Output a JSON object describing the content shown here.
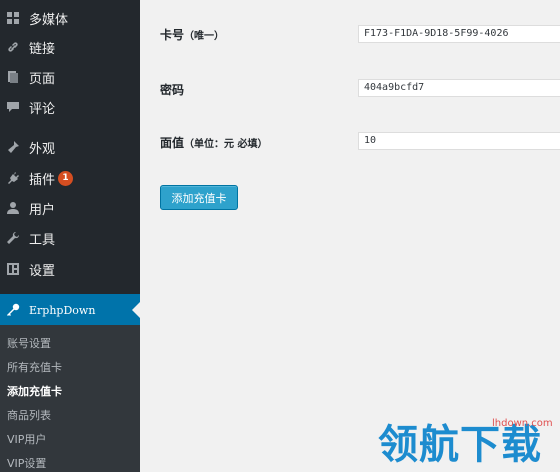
{
  "sidebar": {
    "items": [
      {
        "label": "多媒体",
        "icon": "media-icon"
      },
      {
        "label": "链接",
        "icon": "link-icon"
      },
      {
        "label": "页面",
        "icon": "page-icon"
      },
      {
        "label": "评论",
        "icon": "comment-icon"
      },
      {
        "label": "外观",
        "icon": "appearance-icon"
      },
      {
        "label": "插件",
        "icon": "plugin-icon",
        "badge": "1"
      },
      {
        "label": "用户",
        "icon": "user-icon"
      },
      {
        "label": "工具",
        "icon": "tools-icon"
      },
      {
        "label": "设置",
        "icon": "settings-icon"
      }
    ],
    "active": {
      "label": "ErphpDown",
      "icon": "key-icon"
    },
    "submenu": [
      "账号设置",
      "所有充值卡",
      "添加充值卡",
      "商品列表",
      "VIP用户",
      "VIP设置"
    ],
    "current_submenu": "添加充值卡"
  },
  "form": {
    "card_label": "卡号",
    "card_note": "（唯一）",
    "card_value": "F173-F1DA-9D18-5F99-4026",
    "password_label": "密码",
    "password_value": "404a9bcfd7",
    "amount_label": "面值",
    "amount_note": "（单位：元 必填）",
    "amount_value": "10",
    "submit_label": "添加充值卡"
  },
  "watermark": {
    "text": "领航下载",
    "url": "lhdown.com"
  },
  "colors": {
    "sidebar_bg": "#23282d",
    "active_bg": "#0073aa",
    "button_bg": "#2ea2cc",
    "badge": "#d54e21"
  }
}
